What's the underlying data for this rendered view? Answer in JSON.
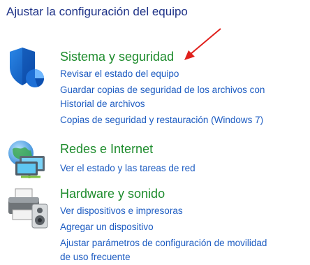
{
  "header": {
    "title": "Ajustar la configuración del equipo"
  },
  "categories": [
    {
      "title": "Sistema y seguridad",
      "icon": "shield-icon",
      "links": [
        "Revisar el estado del equipo",
        "Guardar copias de seguridad de los archivos con",
        "Historial de archivos",
        "Copias de seguridad y restauración (Windows 7)"
      ]
    },
    {
      "title": "Redes e Internet",
      "icon": "network-globe-icon",
      "links": [
        "Ver el estado y las tareas de red"
      ]
    },
    {
      "title": "Hardware y sonido",
      "icon": "printer-speaker-icon",
      "links": [
        "Ver dispositivos e impresoras",
        "Agregar un dispositivo",
        "Ajustar parámetros de configuración de movilidad",
        "de uso frecuente"
      ]
    }
  ],
  "colors": {
    "header": "#1e3287",
    "category_title": "#1e8c2d",
    "link": "#1d5cc2",
    "arrow": "#e0201c"
  }
}
